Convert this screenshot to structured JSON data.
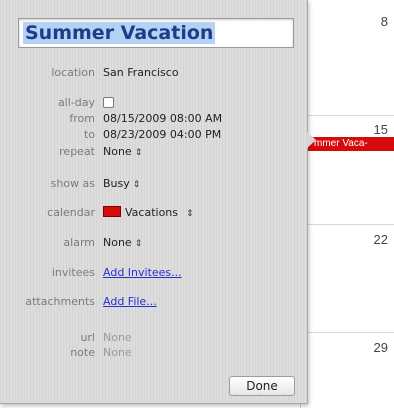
{
  "calendar": {
    "day_numbers": [
      "8",
      "15",
      "22",
      "29"
    ],
    "event_bar_label": "mmer Vaca-",
    "event_color": "#d60a0a"
  },
  "event": {
    "title": "Summer Vacation",
    "fields": {
      "location": {
        "label": "location",
        "value": "San Francisco"
      },
      "all_day": {
        "label": "all-day",
        "checked": false
      },
      "from": {
        "label": "from",
        "value": "08/15/2009 08:00 AM"
      },
      "to": {
        "label": "to",
        "value": "08/23/2009 04:00 PM"
      },
      "repeat": {
        "label": "repeat",
        "value": "None"
      },
      "show_as": {
        "label": "show as",
        "value": "Busy"
      },
      "calendar": {
        "label": "calendar",
        "value": "Vacations",
        "color": "#d60a0a"
      },
      "alarm": {
        "label": "alarm",
        "value": "None"
      },
      "invitees": {
        "label": "invitees",
        "value": "Add Invitees..."
      },
      "attachments": {
        "label": "attachments",
        "value": "Add File..."
      },
      "url": {
        "label": "url",
        "value": "None"
      },
      "note": {
        "label": "note",
        "value": "None"
      }
    },
    "stepper_glyph": "⇕",
    "done_label": "Done"
  }
}
